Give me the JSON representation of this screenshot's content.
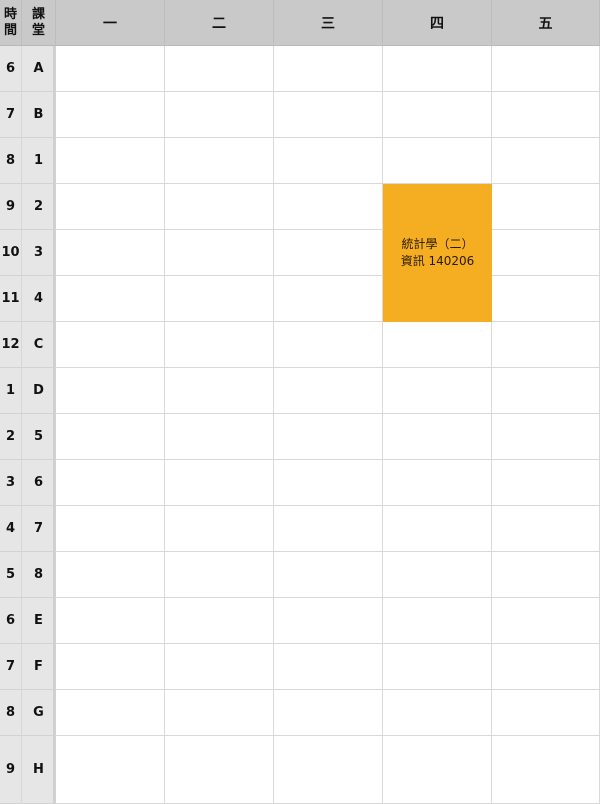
{
  "header": {
    "time_label_1": "時",
    "time_label_2": "間",
    "period_label_1": "課",
    "period_label_2": "堂",
    "days": [
      "一",
      "二",
      "三",
      "四",
      "五"
    ]
  },
  "rows": [
    {
      "time": "6",
      "period": "A"
    },
    {
      "time": "7",
      "period": "B"
    },
    {
      "time": "8",
      "period": "1"
    },
    {
      "time": "9",
      "period": "2"
    },
    {
      "time": "10",
      "period": "3"
    },
    {
      "time": "11",
      "period": "4"
    },
    {
      "time": "12",
      "period": "C"
    },
    {
      "time": "1",
      "period": "D"
    },
    {
      "time": "2",
      "period": "5"
    },
    {
      "time": "3",
      "period": "6"
    },
    {
      "time": "4",
      "period": "7"
    },
    {
      "time": "5",
      "period": "8"
    },
    {
      "time": "6",
      "period": "E"
    },
    {
      "time": "7",
      "period": "F"
    },
    {
      "time": "8",
      "period": "G"
    },
    {
      "time": "9",
      "period": "H"
    }
  ],
  "course": {
    "name": "統計學（二）",
    "room": "資訊 140206",
    "color": "#f5ae22"
  }
}
